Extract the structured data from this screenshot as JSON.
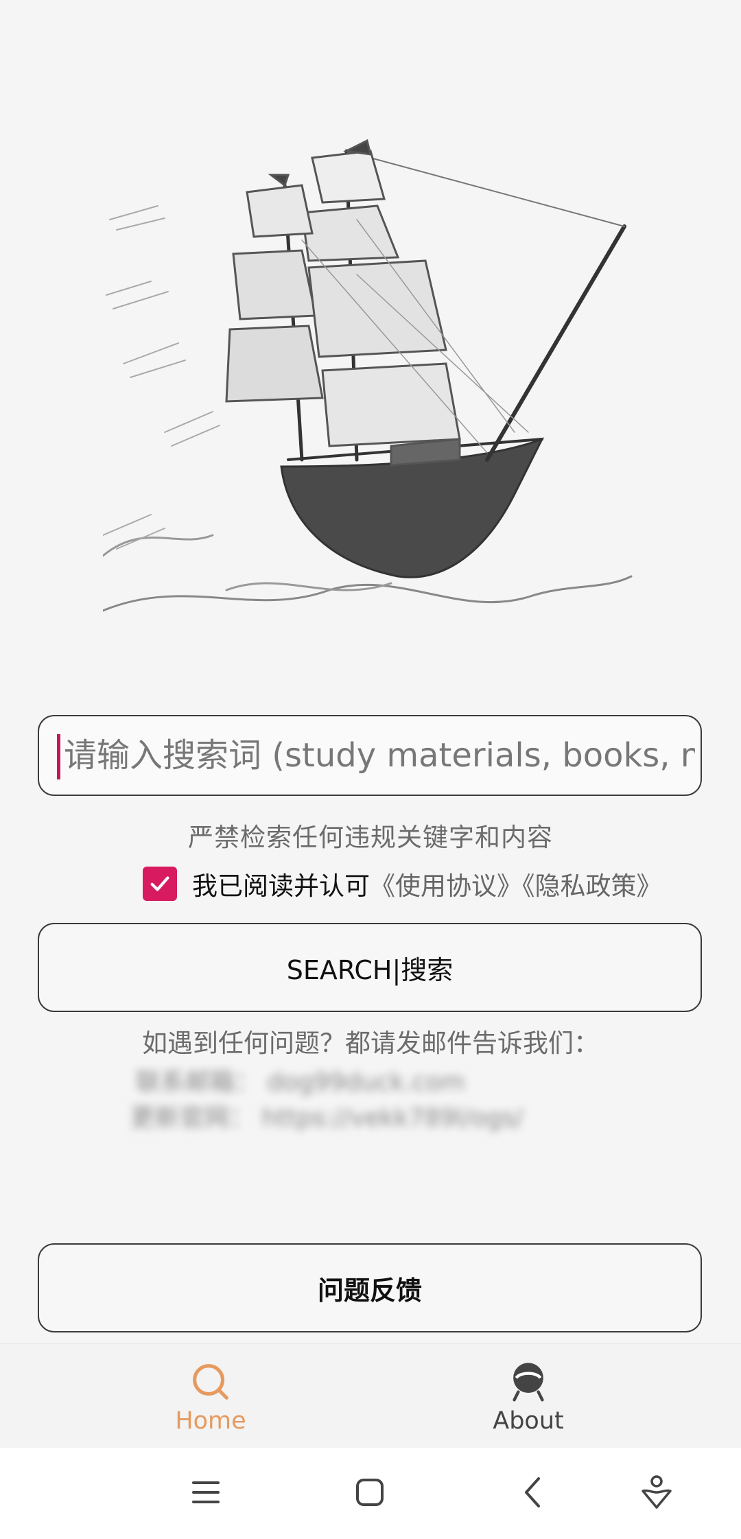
{
  "search": {
    "placeholder": "请输入搜索词 (study materials, books, m"
  },
  "notice_text": "严禁检索任何违规关键字和内容",
  "agreement": {
    "checked": true,
    "text": "我已阅读并认可",
    "terms_link": "《使用协议》",
    "privacy_link": "《隐私政策》"
  },
  "search_button_label": "SEARCH|搜索",
  "contact": {
    "question": "如遇到任何问题？都请发邮件告诉我们：",
    "email_line": "联系邮箱：  dog99duck.com",
    "site_line": "更新官网：  https://vekk789l/ogs/"
  },
  "feedback_button_label": "问题反馈",
  "bottom_nav": {
    "items": [
      {
        "label": "Home",
        "icon": "search-icon",
        "active": true
      },
      {
        "label": "About",
        "icon": "about-icon",
        "active": false
      }
    ]
  },
  "system_nav": {
    "icons": [
      "menu-icon",
      "home-square-icon",
      "back-icon",
      "assistant-icon"
    ]
  },
  "colors": {
    "accent": "#d81b60",
    "active_tab": "#e69a5f",
    "background": "#f5f5f5"
  }
}
